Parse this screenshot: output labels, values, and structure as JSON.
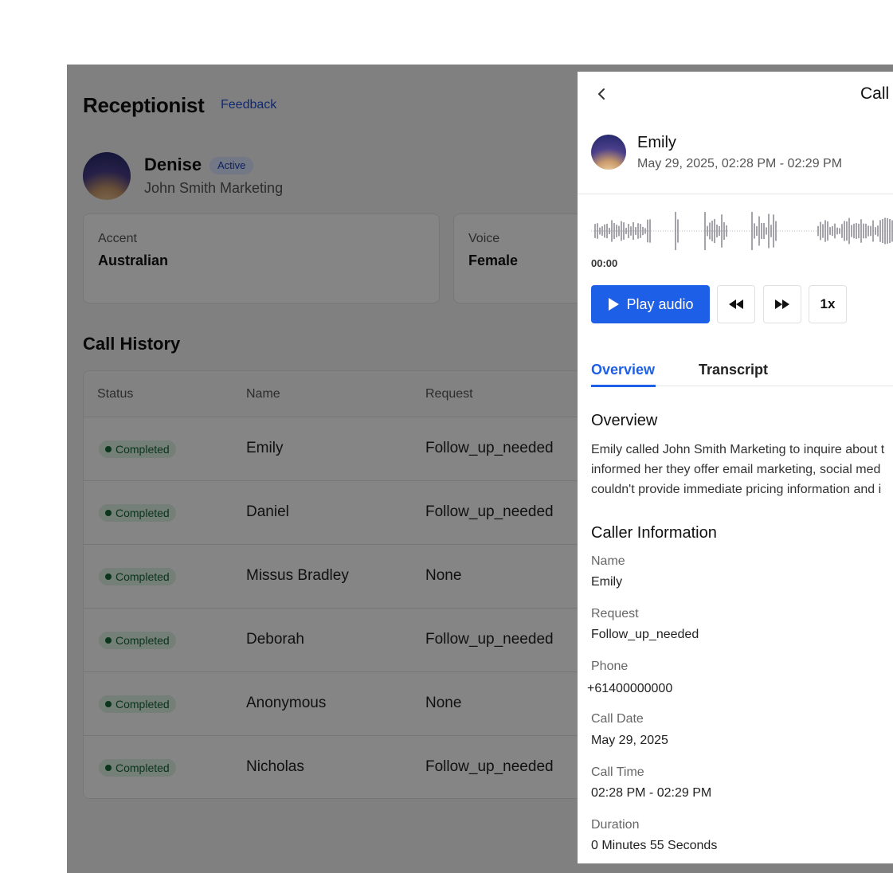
{
  "app": {
    "title": "Receptionist",
    "feedback_label": "Feedback",
    "agent": {
      "name": "Denise",
      "status": "Active",
      "company": "John Smith Marketing"
    },
    "settings": [
      {
        "label": "Accent",
        "value": "Australian"
      },
      {
        "label": "Voice",
        "value": "Female"
      }
    ],
    "call_history": {
      "title": "Call History",
      "columns": [
        "Status",
        "Name",
        "Request"
      ],
      "rows": [
        {
          "status": "Completed",
          "name": "Emily",
          "request": "Follow_up_needed"
        },
        {
          "status": "Completed",
          "name": "Daniel",
          "request": "Follow_up_needed"
        },
        {
          "status": "Completed",
          "name": "Missus Bradley",
          "request": "None"
        },
        {
          "status": "Completed",
          "name": "Deborah",
          "request": "Follow_up_needed"
        },
        {
          "status": "Completed",
          "name": "Anonymous",
          "request": "None"
        },
        {
          "status": "Completed",
          "name": "Nicholas",
          "request": "Follow_up_needed"
        }
      ]
    }
  },
  "panel": {
    "title": "Call",
    "back_icon": "chevron-left-icon",
    "caller": {
      "name": "Emily",
      "datetime": "May 29, 2025, 02:28 PM - 02:29 PM"
    },
    "player": {
      "timecode": "00:00",
      "play_label": "Play audio",
      "speed_label": "1x",
      "accent_color": "#1d5fe6"
    },
    "tabs": [
      {
        "label": "Overview",
        "active": true
      },
      {
        "label": "Transcript",
        "active": false
      }
    ],
    "overview": {
      "heading": "Overview",
      "lines": [
        "Emily called John Smith Marketing to inquire about t",
        "informed her they offer email marketing, social med",
        "couldn't provide immediate pricing information and i"
      ]
    },
    "caller_info": {
      "heading": "Caller Information",
      "fields": [
        {
          "label": "Name",
          "value": "Emily"
        },
        {
          "label": "Request",
          "value": "Follow_up_needed"
        },
        {
          "label": "Phone",
          "value": "+61400000000"
        },
        {
          "label": "Call Date",
          "value": "May 29, 2025"
        },
        {
          "label": "Call Time",
          "value": "02:28 PM - 02:29 PM"
        },
        {
          "label": "Duration",
          "value": "0 Minutes 55 Seconds"
        }
      ]
    }
  }
}
